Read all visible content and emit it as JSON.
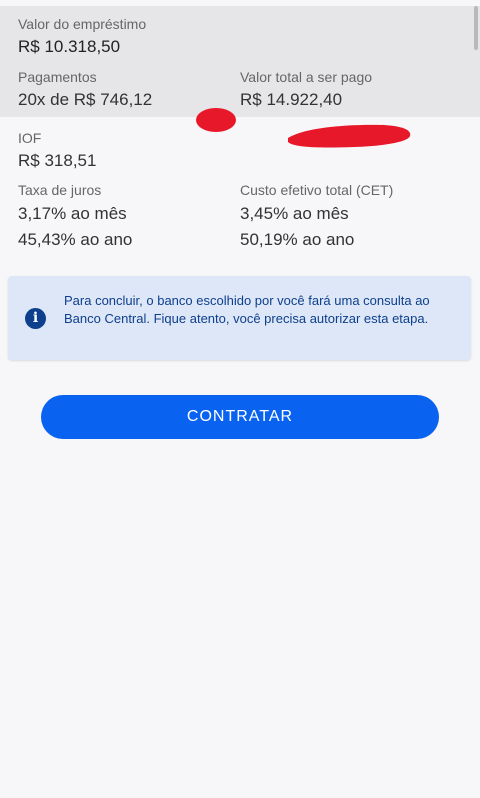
{
  "summary": {
    "loan_label": "Valor do empréstimo",
    "loan_value": "R$ 10.318,50",
    "payments_label": "Pagamentos",
    "payments_value": "20x de R$ 746,12",
    "total_label": "Valor total a ser pago",
    "total_value": "R$ 14.922,40"
  },
  "details": {
    "iof_label": "IOF",
    "iof_value": "R$ 318,51",
    "interest_label": "Taxa de juros",
    "interest_month": "3,17% ao mês",
    "interest_year": "45,43% ao ano",
    "cet_label": "Custo efetivo total (CET)",
    "cet_month": "3,45% ao mês",
    "cet_year": "50,19% ao ano"
  },
  "notice": {
    "icon": "info-icon",
    "text": "Para concluir, o banco escolhido por você fará uma consulta ao Banco Central. Fique atento, você precisa autorizar esta etapa."
  },
  "action": {
    "contract_label": "CONTRATAR"
  },
  "colors": {
    "button": "#0a63f0",
    "notice_bg": "#dde7f7",
    "notice_text": "#0e3f8d",
    "scribble": "#e8182b"
  }
}
